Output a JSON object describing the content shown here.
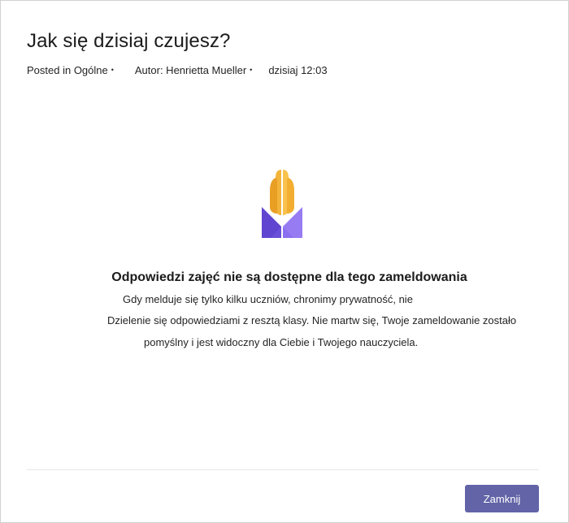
{
  "dialog": {
    "title": "Jak się dzisiaj czujesz?",
    "meta": {
      "posted_in": "Posted in Ogólne",
      "author": "Autor: Henrietta Mueller",
      "time": "dzisiaj 12:03",
      "separator": "•"
    },
    "empty_state": {
      "icon": "praying-hands-icon",
      "heading": "Odpowiedzi zajęć nie są dostępne dla tego zameldowania",
      "line1": "Gdy melduje się tylko kilku uczniów, chronimy prywatność, nie",
      "line2": "Dzielenie się odpowiedziami z resztą klasy. Nie martw się, Twoje zameldowanie zostało",
      "line3": "pomyślny i jest widoczny dla Ciebie i Twojego nauczyciela."
    },
    "footer": {
      "close_label": "Zamknij"
    }
  },
  "colors": {
    "accent": "#6264a7",
    "hands": "#f7b538",
    "sleeve": "#7b5fe0"
  }
}
